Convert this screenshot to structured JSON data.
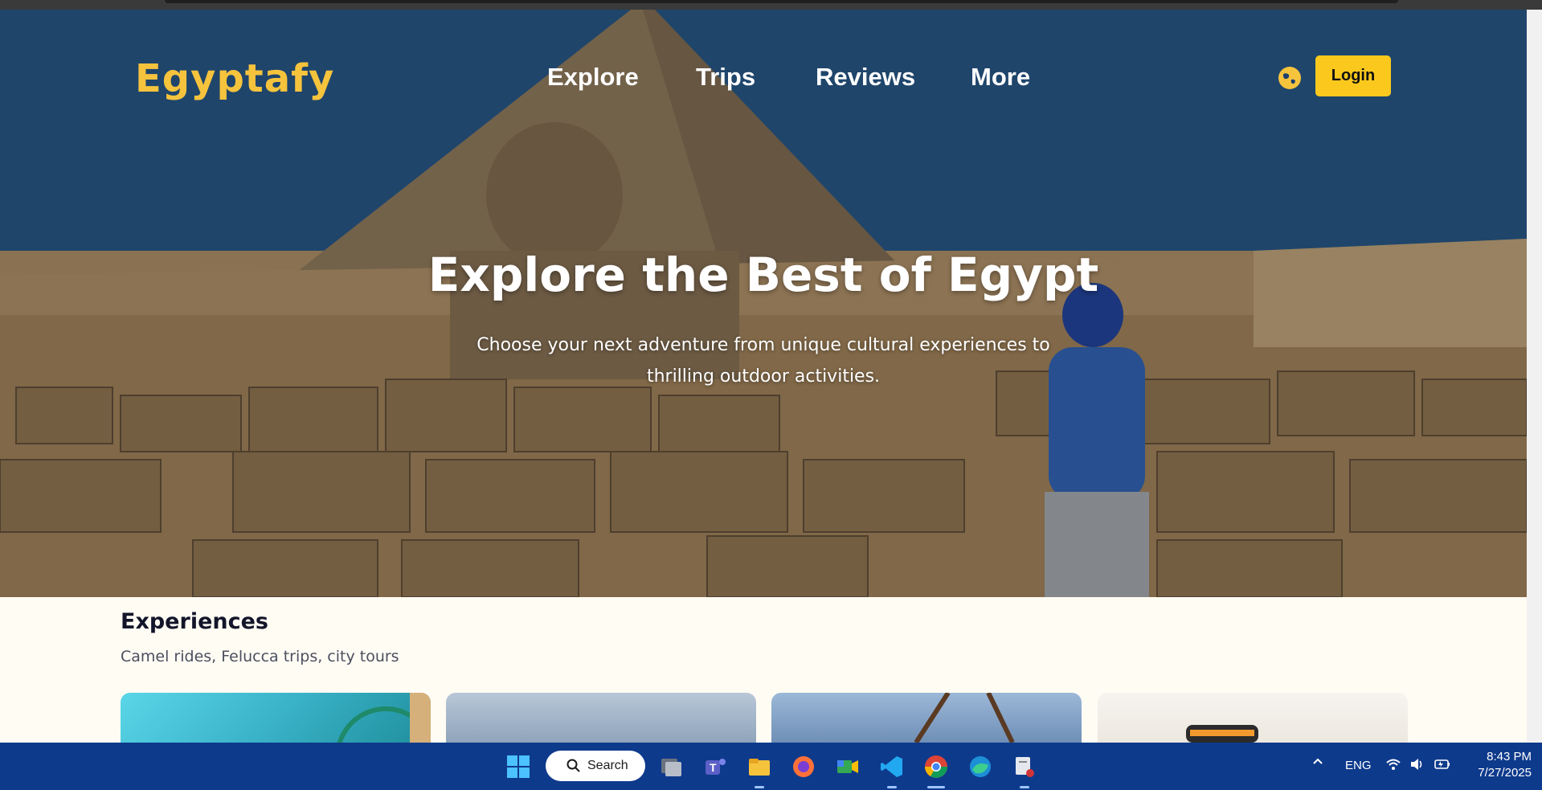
{
  "brand": {
    "logo_text": "Egyptafy",
    "accent": "#f6c33d"
  },
  "nav": {
    "items": [
      {
        "label": "Explore"
      },
      {
        "label": "Trips"
      },
      {
        "label": "Reviews"
      },
      {
        "label": "More"
      }
    ],
    "language_icon": "globe-icon",
    "login_label": "Login",
    "login_color": "#fbc91d"
  },
  "hero": {
    "title": "Explore the Best of Egypt",
    "subtitle": "Choose your next adventure from unique cultural experiences to thrilling outdoor activities."
  },
  "experiences": {
    "title": "Experiences",
    "subtitle": "Camel rides, Felucca trips, city tours"
  },
  "taskbar": {
    "search_label": "Search",
    "apps": [
      "windows-start-icon",
      "task-view-icon",
      "teams-icon",
      "file-explorer-icon",
      "firefox-icon",
      "meet-icon",
      "vscode-icon",
      "chrome-icon",
      "edge-icon",
      "snipping-tool-icon"
    ],
    "language": "ENG",
    "time": "8:43 PM",
    "date": "7/27/2025",
    "color": "#0e3a8c"
  }
}
